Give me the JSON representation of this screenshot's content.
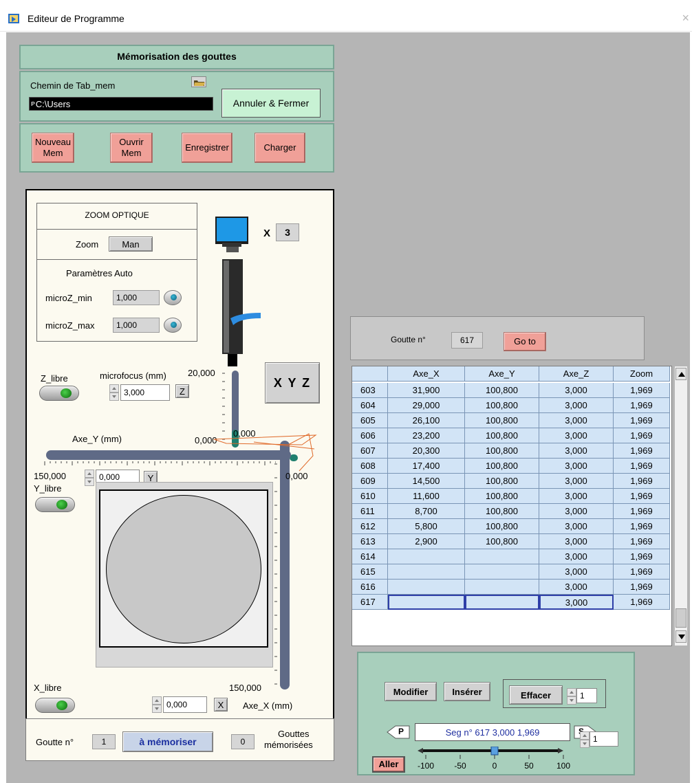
{
  "window": {
    "title": "Editeur de Programme",
    "close_glyph": "×",
    "icon": "labview-vi-icon"
  },
  "memo": {
    "title": "Mémorisation des gouttes",
    "path_label": "Chemin de Tab_mem",
    "path_value": "C:\\Users",
    "path_prefix": "ᴘ",
    "cancel_label": "Annuler & Fermer",
    "buttons": [
      {
        "line1": "Nouveau",
        "line2": "Mem"
      },
      {
        "line1": "Ouvrir",
        "line2": "Mem"
      },
      {
        "line1": "Enregistrer",
        "line2": ""
      },
      {
        "line1": "Charger",
        "line2": ""
      }
    ]
  },
  "zoom_optique": {
    "title": "ZOOM OPTIQUE",
    "zoom_label": "Zoom",
    "zoom_mode": "Man",
    "params_label": "Paramètres  Auto",
    "microz_min_label": "microZ_min",
    "microz_min_value": "1,000",
    "microz_max_label": "microZ_max",
    "microz_max_value": "1,000"
  },
  "camera": {
    "multiplier_label": "X",
    "multiplier_value": "3"
  },
  "xyz_button": "X Y Z",
  "z_axis": {
    "free_label": "Z_libre",
    "focus_label": "microfocus (mm)",
    "focus_value": "3,000",
    "set_button": "Z",
    "max_label": "20,000",
    "min_label": "0,000",
    "marker_label": "0,000"
  },
  "y_axis": {
    "label": "Axe_Y (mm)",
    "free_label": "Y_libre",
    "max_label": "150,000",
    "value": "0,000",
    "set_button": "Y",
    "right_label": "0,000"
  },
  "x_axis": {
    "free_label": "X_libre",
    "label": "Axe_X (mm)",
    "max_label": "150,000",
    "value": "0,000",
    "set_button": "X"
  },
  "goutte_bottom": {
    "label": "Goutte  n°",
    "value": "1",
    "memorize_button": "à mémoriser",
    "count_value": "0",
    "count_label_1": "Gouttes",
    "count_label_2": "mémorisées"
  },
  "goto_panel": {
    "label": "Goutte n°",
    "value": "617",
    "button": "Go to"
  },
  "table": {
    "columns": [
      "",
      "Axe_X",
      "Axe_Y",
      "Axe_Z",
      "Zoom"
    ],
    "rows": [
      [
        "603",
        "31,900",
        "100,800",
        "3,000",
        "1,969"
      ],
      [
        "604",
        "29,000",
        "100,800",
        "3,000",
        "1,969"
      ],
      [
        "605",
        "26,100",
        "100,800",
        "3,000",
        "1,969"
      ],
      [
        "606",
        "23,200",
        "100,800",
        "3,000",
        "1,969"
      ],
      [
        "607",
        "20,300",
        "100,800",
        "3,000",
        "1,969"
      ],
      [
        "608",
        "17,400",
        "100,800",
        "3,000",
        "1,969"
      ],
      [
        "609",
        "14,500",
        "100,800",
        "3,000",
        "1,969"
      ],
      [
        "610",
        "11,600",
        "100,800",
        "3,000",
        "1,969"
      ],
      [
        "611",
        "8,700",
        "100,800",
        "3,000",
        "1,969"
      ],
      [
        "612",
        "5,800",
        "100,800",
        "3,000",
        "1,969"
      ],
      [
        "613",
        "2,900",
        "100,800",
        "3,000",
        "1,969"
      ],
      [
        "614",
        "",
        "",
        "3,000",
        "1,969"
      ],
      [
        "615",
        "",
        "",
        "3,000",
        "1,969"
      ],
      [
        "616",
        "",
        "",
        "3,000",
        "1,969"
      ],
      [
        "617",
        "",
        "",
        "3,000",
        "1,969"
      ]
    ]
  },
  "edit_panel": {
    "modify_button": "Modifier",
    "insert_button": "Insérer",
    "erase_button": "Effacer",
    "erase_count": "1",
    "prev_label": "P",
    "next_label": "S",
    "seg_text": "Seg n°  617   3,000 1,969",
    "go_button": "Aller",
    "slider_ticks": [
      "-100",
      "-50",
      "0",
      "50",
      "100"
    ],
    "slider_value": 0,
    "step_value": "1"
  }
}
